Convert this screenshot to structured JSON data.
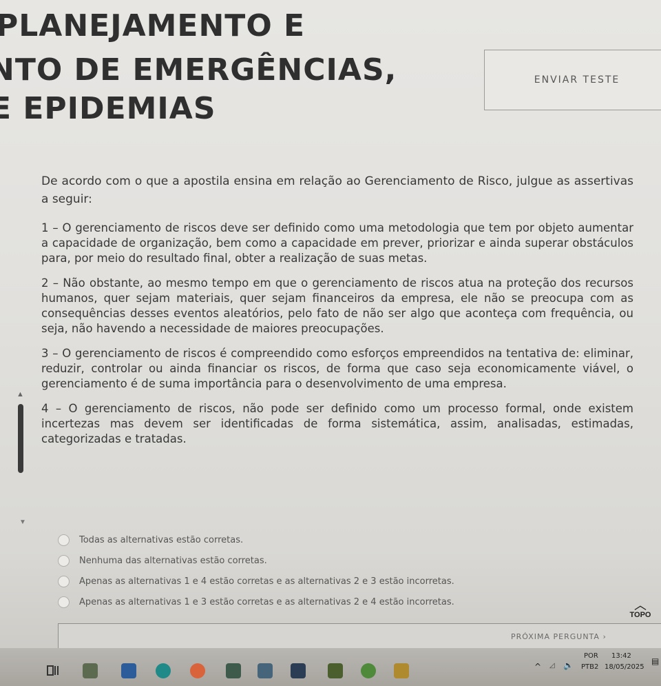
{
  "header": {
    "title_line1": "PLANEJAMENTO E",
    "title_line2": "NTO DE EMERGÊNCIAS,",
    "title_line3": "E EPIDEMIAS",
    "send_button": "ENVIAR TESTE"
  },
  "question": {
    "intro": "De acordo com o que a apostila ensina em relação ao Gerenciamento de Risco, julgue as assertivas a seguir:",
    "statements": [
      "1 – O gerenciamento de riscos deve ser definido como uma metodologia que tem por objeto aumentar a capacidade de organização, bem como a capacidade em prever, priorizar e ainda superar obstáculos para, por meio do resultado final, obter a realização de suas metas.",
      "2 – Não obstante, ao mesmo tempo em que o gerenciamento de riscos atua na proteção dos recursos humanos, quer sejam materiais, quer sejam financeiros da empresa, ele não se preocupa com as consequências desses eventos aleatórios, pelo fato de não ser algo que aconteça com frequência, ou seja, não havendo a necessidade de maiores preocupações.",
      "3 – O gerenciamento de riscos é compreendido como esforços empreendidos na tentativa de: eliminar, reduzir, controlar ou ainda financiar os riscos, de forma que caso seja economicamente viável, o gerenciamento é de suma importância para o desenvolvimento de uma empresa.",
      "4 – O gerenciamento de riscos, não pode ser definido como um processo formal, onde existem incertezas mas devem ser identificadas de forma sistemática, assim, analisadas, estimadas, categorizadas e tratadas."
    ]
  },
  "options": [
    "Todas as alternativas estão corretas.",
    "Nenhuma das alternativas estão corretas.",
    "Apenas as alternativas 1 e 4 estão corretas e as alternativas 2 e 3 estão incorretas.",
    "Apenas as alternativas 1 e 3 estão corretas e as alternativas 2 e 4 estão incorretas."
  ],
  "navigation": {
    "top_label": "TOPO",
    "next_label": "PRÓXIMA PERGUNTA ›"
  },
  "taskbar": {
    "language": "POR",
    "layout": "PTB2",
    "time": "13:42",
    "date": "18/05/2025",
    "icons": [
      "task-view-icon",
      "file-manager-icon",
      "folder-icon",
      "edge-icon",
      "firefox-icon",
      "calculator-icon",
      "image-viewer-icon",
      "camera-icon",
      "app-icon",
      "chrome-icon",
      "files-icon"
    ]
  }
}
